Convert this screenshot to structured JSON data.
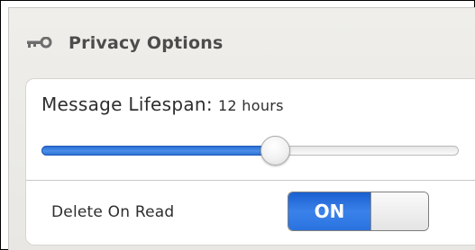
{
  "header": {
    "icon": "key-icon",
    "title": "Privacy Options"
  },
  "lifespan": {
    "label": "Message Lifespan:",
    "value": "12 hours",
    "slider_fraction": 0.56
  },
  "delete_on_read": {
    "label": "Delete On Read",
    "toggle_label": "ON",
    "enabled": true
  },
  "colors": {
    "accent": "#2f73d6",
    "panel_bg": "#efeeea",
    "header_text": "#4c4c4c"
  }
}
